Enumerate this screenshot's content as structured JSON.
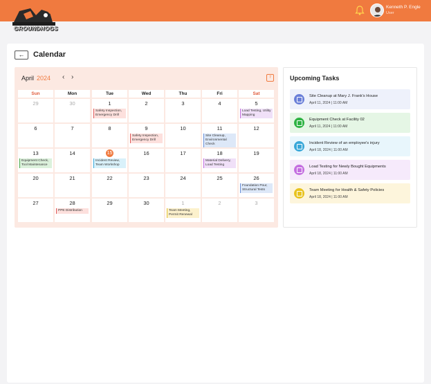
{
  "header": {
    "logo_text": "GROUNDHOGS",
    "user_name": "Kenneth P. Engle",
    "user_role": "User"
  },
  "page": {
    "title": "Calendar",
    "back_label": "←"
  },
  "calendar": {
    "month": "April",
    "year": "2024",
    "prev": "‹",
    "next": "›",
    "icon_label": "7",
    "weekdays": [
      "Sun",
      "Mon",
      "Tue",
      "Wed",
      "Thu",
      "Fri",
      "Sat"
    ],
    "weeks": [
      [
        {
          "d": "29",
          "muted": true
        },
        {
          "d": "30",
          "muted": true
        },
        {
          "d": "1",
          "events": [
            {
              "t": "Safety Inspection, Emergency Drill",
              "c": "red"
            }
          ]
        },
        {
          "d": "2"
        },
        {
          "d": "3"
        },
        {
          "d": "4"
        },
        {
          "d": "5",
          "events": [
            {
              "t": "Load Testing, Utility Mapping",
              "c": "purple"
            }
          ]
        }
      ],
      [
        {
          "d": "6"
        },
        {
          "d": "7"
        },
        {
          "d": "8"
        },
        {
          "d": "9",
          "events": [
            {
              "t": "Safety Inspection, Emergency Drill",
              "c": "red"
            }
          ]
        },
        {
          "d": "10"
        },
        {
          "d": "11",
          "events": [
            {
              "t": "Site Cleanup, Environmental Check",
              "c": "blue"
            }
          ]
        },
        {
          "d": "12"
        }
      ],
      [
        {
          "d": "13",
          "events": [
            {
              "t": "Equipment Check, Tool Maintenance",
              "c": "green"
            }
          ]
        },
        {
          "d": "14"
        },
        {
          "d": "15",
          "today": true,
          "events": [
            {
              "t": "Incident Review, Team Workshop",
              "c": "cyan"
            }
          ]
        },
        {
          "d": "16"
        },
        {
          "d": "17"
        },
        {
          "d": "18",
          "events": [
            {
              "t": "Material Delivery, Load Testing",
              "c": "purple"
            }
          ]
        },
        {
          "d": "19"
        }
      ],
      [
        {
          "d": "20"
        },
        {
          "d": "21"
        },
        {
          "d": "22"
        },
        {
          "d": "23"
        },
        {
          "d": "24"
        },
        {
          "d": "25"
        },
        {
          "d": "26",
          "events": [
            {
              "t": "Foundation Pour, Structural Tests",
              "c": "blue"
            }
          ]
        }
      ],
      [
        {
          "d": "27"
        },
        {
          "d": "28",
          "events": [
            {
              "t": "PPE Distribution",
              "c": "red"
            }
          ]
        },
        {
          "d": "29"
        },
        {
          "d": "30"
        },
        {
          "d": "1",
          "muted": true,
          "events": [
            {
              "t": "Team Meeting, Permit Renewal",
              "c": "yellow"
            }
          ]
        },
        {
          "d": "2",
          "muted": true
        },
        {
          "d": "3",
          "muted": true
        }
      ]
    ]
  },
  "upcoming": {
    "title": "Upcoming Tasks",
    "tasks": [
      {
        "title": "Site Cleanup at Mary J. Frank's House",
        "date": "April 11, 2024 | 11:00 AM",
        "bg": "#eef1fb",
        "icon": "#6a7fd8"
      },
      {
        "title": "Equipment Check at Facility 02",
        "date": "April 11, 2024 | 11:00 AM",
        "bg": "#e5f6e5",
        "icon": "#2fb344"
      },
      {
        "title": "Incident Review of an employee's injury",
        "date": "April 18, 2024 | 11:00 AM",
        "bg": "#e8f6fc",
        "icon": "#3aa8d8"
      },
      {
        "title": "Load Testing for Newly Bought Equipments",
        "date": "April 18, 2024 | 11:00 AM",
        "bg": "#f6eafb",
        "icon": "#c46fe0"
      },
      {
        "title": "Team Meeting for Health & Safety Policies",
        "date": "April 18, 2024 | 11:00 AM",
        "bg": "#fdf5dc",
        "icon": "#e8c31f"
      }
    ]
  }
}
